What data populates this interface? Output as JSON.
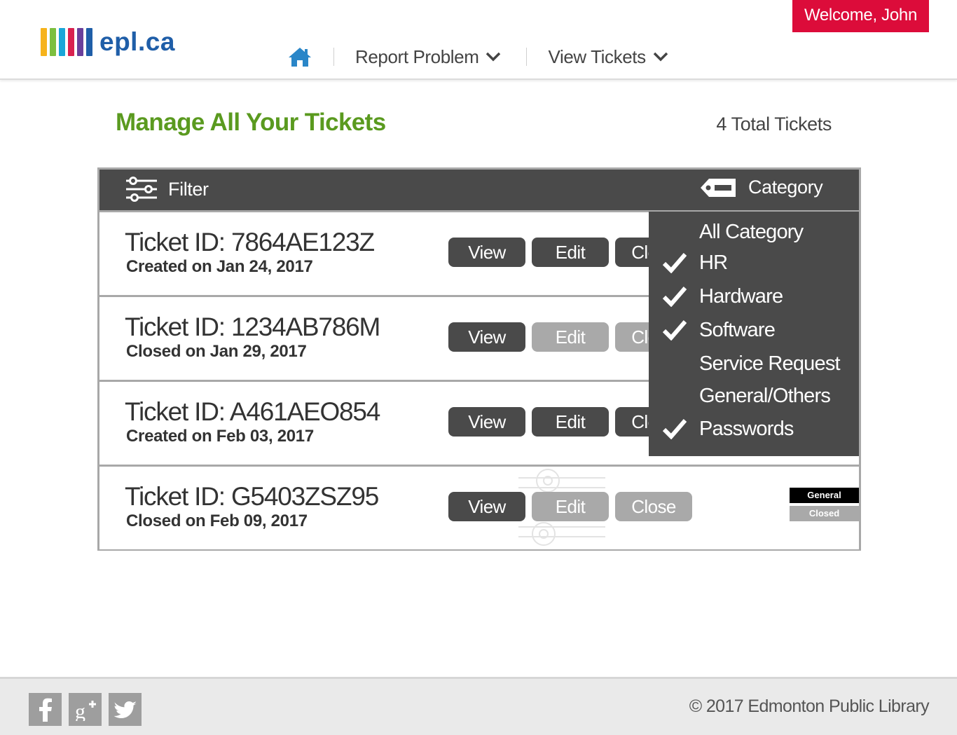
{
  "brand": {
    "logo_text": "epl.ca",
    "bar_colors": [
      "#f6b31b",
      "#7cbf3f",
      "#1aa6d8",
      "#d9214f",
      "#6a3f9b",
      "#1f5ea8"
    ]
  },
  "header": {
    "welcome": "Welcome, John",
    "nav": {
      "home_icon": "home-icon",
      "report_problem": "Report Problem",
      "view_tickets": "View Tickets"
    }
  },
  "page": {
    "title": "Manage All Your Tickets",
    "total": "4 Total Tickets"
  },
  "toolbar": {
    "filter_label": "Filter",
    "category_label": "Category"
  },
  "tickets": [
    {
      "id": "Ticket ID: 7864AE123Z",
      "date": "Created on Jan 24, 2017",
      "view": "View",
      "edit": "Edit",
      "close": "Close",
      "edit_enabled": true,
      "close_enabled": true
    },
    {
      "id": "Ticket ID: 1234AB786M",
      "date": "Closed on Jan 29, 2017",
      "view": "View",
      "edit": "Edit",
      "close": "Close",
      "edit_enabled": false,
      "close_enabled": false
    },
    {
      "id": "Ticket ID: A461AEO854",
      "date": "Created on Feb 03, 2017",
      "view": "View",
      "edit": "Edit",
      "close": "Close",
      "edit_enabled": true,
      "close_enabled": true
    },
    {
      "id": "Ticket ID: G5403ZSZ95",
      "date": "Closed on Feb 09, 2017",
      "view": "View",
      "edit": "Edit",
      "close": "Close",
      "edit_enabled": false,
      "close_enabled": false,
      "category_badge": "General",
      "status_badge": "Closed"
    }
  ],
  "category_menu": {
    "items": [
      {
        "label": "All Category",
        "checked": false
      },
      {
        "label": "HR",
        "checked": true
      },
      {
        "label": "Hardware",
        "checked": true
      },
      {
        "label": "Software",
        "checked": true
      },
      {
        "label": "Service Request",
        "checked": false
      },
      {
        "label": "General/Others",
        "checked": false
      },
      {
        "label": "Passwords",
        "checked": true
      }
    ]
  },
  "footer": {
    "social": [
      "facebook-icon",
      "google-plus-icon",
      "twitter-icon"
    ],
    "copyright": "© 2017 Edmonton Public Library"
  },
  "colors": {
    "accent_red": "#dc0c3a",
    "title_green": "#5a9a1f",
    "panel_dark": "#4a4a4a",
    "disabled_grey": "#a9a9a9"
  }
}
